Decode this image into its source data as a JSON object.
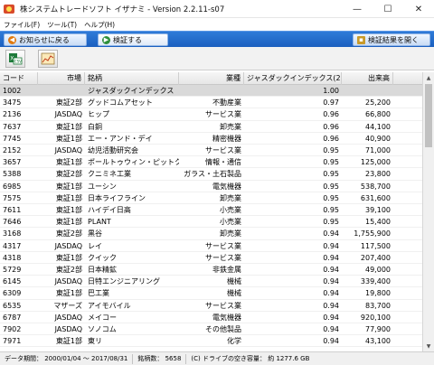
{
  "titlebar": {
    "title": "株システムトレードソフト イザナミ - Version 2.2.11-s07",
    "minimize": "—",
    "maximize": "☐",
    "close": "✕"
  },
  "menu": [
    "ファイル(F)",
    "ツール(T)",
    "ヘルプ(H)"
  ],
  "nav": {
    "back_label": "お知らせに戻る",
    "verify_label": "検証する",
    "open_results_label": "検証結果を開く"
  },
  "toolbar": {
    "csv_label": "CSV"
  },
  "table": {
    "columns": [
      "コード",
      "市場",
      "銘柄",
      "業種",
      "ジャスダックインデックス(20)",
      "出来高"
    ],
    "rows": [
      {
        "code": "1002",
        "market": "",
        "name": "ジャスダックインデックス",
        "sector": "",
        "index": "1.00",
        "volume": ""
      },
      {
        "code": "3475",
        "market": "東証2部",
        "name": "グッドコムアセット",
        "sector": "不動産業",
        "index": "0.97",
        "volume": "25,200"
      },
      {
        "code": "2136",
        "market": "JASDAQ",
        "name": "ヒップ",
        "sector": "サービス業",
        "index": "0.96",
        "volume": "66,800"
      },
      {
        "code": "7637",
        "market": "東証1部",
        "name": "白銅",
        "sector": "卸売業",
        "index": "0.96",
        "volume": "44,100"
      },
      {
        "code": "7745",
        "market": "東証1部",
        "name": "エー・アンド・デイ",
        "sector": "精密機器",
        "index": "0.96",
        "volume": "40,900"
      },
      {
        "code": "2152",
        "market": "JASDAQ",
        "name": "幼児活動研究会",
        "sector": "サービス業",
        "index": "0.95",
        "volume": "71,000"
      },
      {
        "code": "3657",
        "market": "東証1部",
        "name": "ポールトゥウィン・ピットクルー…",
        "sector": "情報・通信",
        "index": "0.95",
        "volume": "125,000"
      },
      {
        "code": "5388",
        "market": "東証2部",
        "name": "クニミネ工業",
        "sector": "ガラス・土石製品",
        "index": "0.95",
        "volume": "23,800"
      },
      {
        "code": "6985",
        "market": "東証1部",
        "name": "ユーシン",
        "sector": "電気機器",
        "index": "0.95",
        "volume": "538,700"
      },
      {
        "code": "7575",
        "market": "東証1部",
        "name": "日本ライフライン",
        "sector": "卸売業",
        "index": "0.95",
        "volume": "631,600"
      },
      {
        "code": "7611",
        "market": "東証1部",
        "name": "ハイデイ日高",
        "sector": "小売業",
        "index": "0.95",
        "volume": "39,100"
      },
      {
        "code": "7646",
        "market": "東証1部",
        "name": "PLANT",
        "sector": "小売業",
        "index": "0.95",
        "volume": "15,400"
      },
      {
        "code": "3168",
        "market": "東証2部",
        "name": "黒谷",
        "sector": "卸売業",
        "index": "0.94",
        "volume": "1,755,900"
      },
      {
        "code": "4317",
        "market": "JASDAQ",
        "name": "レイ",
        "sector": "サービス業",
        "index": "0.94",
        "volume": "117,500"
      },
      {
        "code": "4318",
        "market": "東証1部",
        "name": "クイック",
        "sector": "サービス業",
        "index": "0.94",
        "volume": "207,400"
      },
      {
        "code": "5729",
        "market": "東証2部",
        "name": "日本精鉱",
        "sector": "非鉄金属",
        "index": "0.94",
        "volume": "49,000"
      },
      {
        "code": "6145",
        "market": "JASDAQ",
        "name": "日特エンジニアリング",
        "sector": "機械",
        "index": "0.94",
        "volume": "339,400"
      },
      {
        "code": "6309",
        "market": "東証1部",
        "name": "巴工業",
        "sector": "機械",
        "index": "0.94",
        "volume": "19,800"
      },
      {
        "code": "6535",
        "market": "マザーズ",
        "name": "アイモバイル",
        "sector": "サービス業",
        "index": "0.94",
        "volume": "83,700"
      },
      {
        "code": "6787",
        "market": "JASDAQ",
        "name": "メイコー",
        "sector": "電気機器",
        "index": "0.94",
        "volume": "920,100"
      },
      {
        "code": "7902",
        "market": "JASDAQ",
        "name": "ソノコム",
        "sector": "その他製品",
        "index": "0.94",
        "volume": "77,900"
      },
      {
        "code": "7971",
        "market": "東証1部",
        "name": "東リ",
        "sector": "化学",
        "index": "0.94",
        "volume": "43,100"
      }
    ]
  },
  "status": {
    "period": "データ期間： 2000/01/04 ～ 2017/08/31",
    "count": "銘柄数： 5658",
    "disk": "(C) ドライブの空き容量： 約 1277.6 GB"
  },
  "colors": {
    "nav_bg": "#1b5fbf",
    "selected_row": "#d9d9d9"
  }
}
